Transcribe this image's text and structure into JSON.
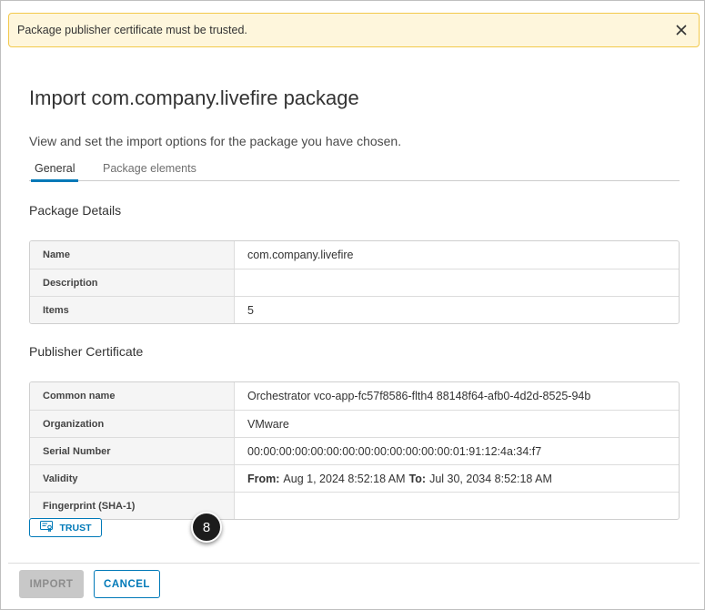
{
  "alert": {
    "message": "Package publisher certificate must be trusted.",
    "close_icon": "close-icon"
  },
  "dialog": {
    "title": "Import com.company.livefire package",
    "subtitle": "View and set the import options for the package you have chosen."
  },
  "tabs": [
    {
      "label": "General",
      "active": true
    },
    {
      "label": "Package elements",
      "active": false
    }
  ],
  "package_details": {
    "section_title": "Package Details",
    "rows": [
      {
        "label": "Name",
        "value": "com.company.livefire"
      },
      {
        "label": "Description",
        "value": ""
      },
      {
        "label": "Items",
        "value": "5"
      }
    ]
  },
  "publisher_certificate": {
    "section_title": "Publisher Certificate",
    "common_name_label": "Common name",
    "common_name": "Orchestrator vco-app-fc57f8586-flth4 88148f64-afb0-4d2d-8525-94b",
    "organization_label": "Organization",
    "organization": "VMware",
    "serial_label": "Serial Number",
    "serial": "00:00:00:00:00:00:00:00:00:00:00:00:00:01:91:12:4a:34:f7",
    "validity_label": "Validity",
    "validity_from_label": "From:",
    "validity_from": "Aug 1, 2024 8:52:18 AM",
    "validity_to_label": "To:",
    "validity_to": "Jul 30, 2034 8:52:18 AM",
    "fingerprint_label": "Fingerprint (SHA-1)",
    "fingerprint": ""
  },
  "trust_button": {
    "label": "TRUST",
    "icon": "certificate-icon"
  },
  "step_badge": "8",
  "footer": {
    "import_label": "IMPORT",
    "cancel_label": "CANCEL"
  },
  "colors": {
    "accent": "#0079b8",
    "alert_bg": "#fef6dc",
    "alert_border": "#f2c94c",
    "disabled_bg": "#c8c8c8"
  }
}
